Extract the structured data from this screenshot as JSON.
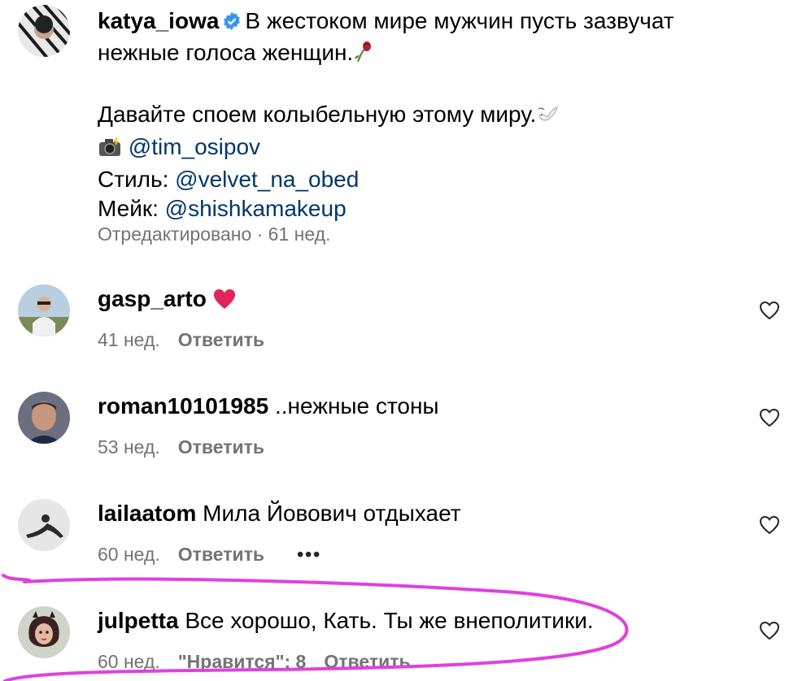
{
  "caption": {
    "username": "katya_iowa",
    "line1": "В жестоком мире мужчин пусть зазвучат",
    "line2": "нежные голоса женщин.",
    "line3": "Давайте споем колыбельную этому миру.",
    "photo_mention": "@tim_osipov",
    "style_label": "Стиль: ",
    "style_mention": "@velvet_na_obed",
    "makeup_label": "Мейк: ",
    "makeup_mention": "@shishkamakeup",
    "meta": "Отредактировано · 61 нед."
  },
  "comments": [
    {
      "username": "gasp_arto",
      "text": "",
      "time": "41 нед.",
      "reply": "Ответить",
      "likes": "",
      "more": ""
    },
    {
      "username": "roman10101985",
      "text": "..нежные стоны",
      "time": "53 нед.",
      "reply": "Ответить",
      "likes": "",
      "more": ""
    },
    {
      "username": "lailaatom",
      "text": "Мила Йовович отдыхает",
      "time": "60 нед.",
      "reply": "Ответить",
      "likes": "",
      "more": "•••"
    },
    {
      "username": "julpetta",
      "text": "Все хорошо, Кать. Ты же внеполитики.",
      "time": "60 нед.",
      "reply": "Ответить",
      "likes": "\"Нравится\": 8",
      "more": ""
    }
  ],
  "colors": {
    "mention": "#00376b",
    "meta": "#737373",
    "highlight": "#e040e0",
    "verified": "#3897f0",
    "heart_emoji": "#e0245e"
  },
  "icons": {
    "verified": "verified-badge-icon",
    "rose": "wilted-rose-emoji",
    "dove": "dove-emoji",
    "camera": "camera-flash-emoji",
    "heart_emoji": "red-heart-emoji",
    "like": "heart-outline-icon"
  }
}
